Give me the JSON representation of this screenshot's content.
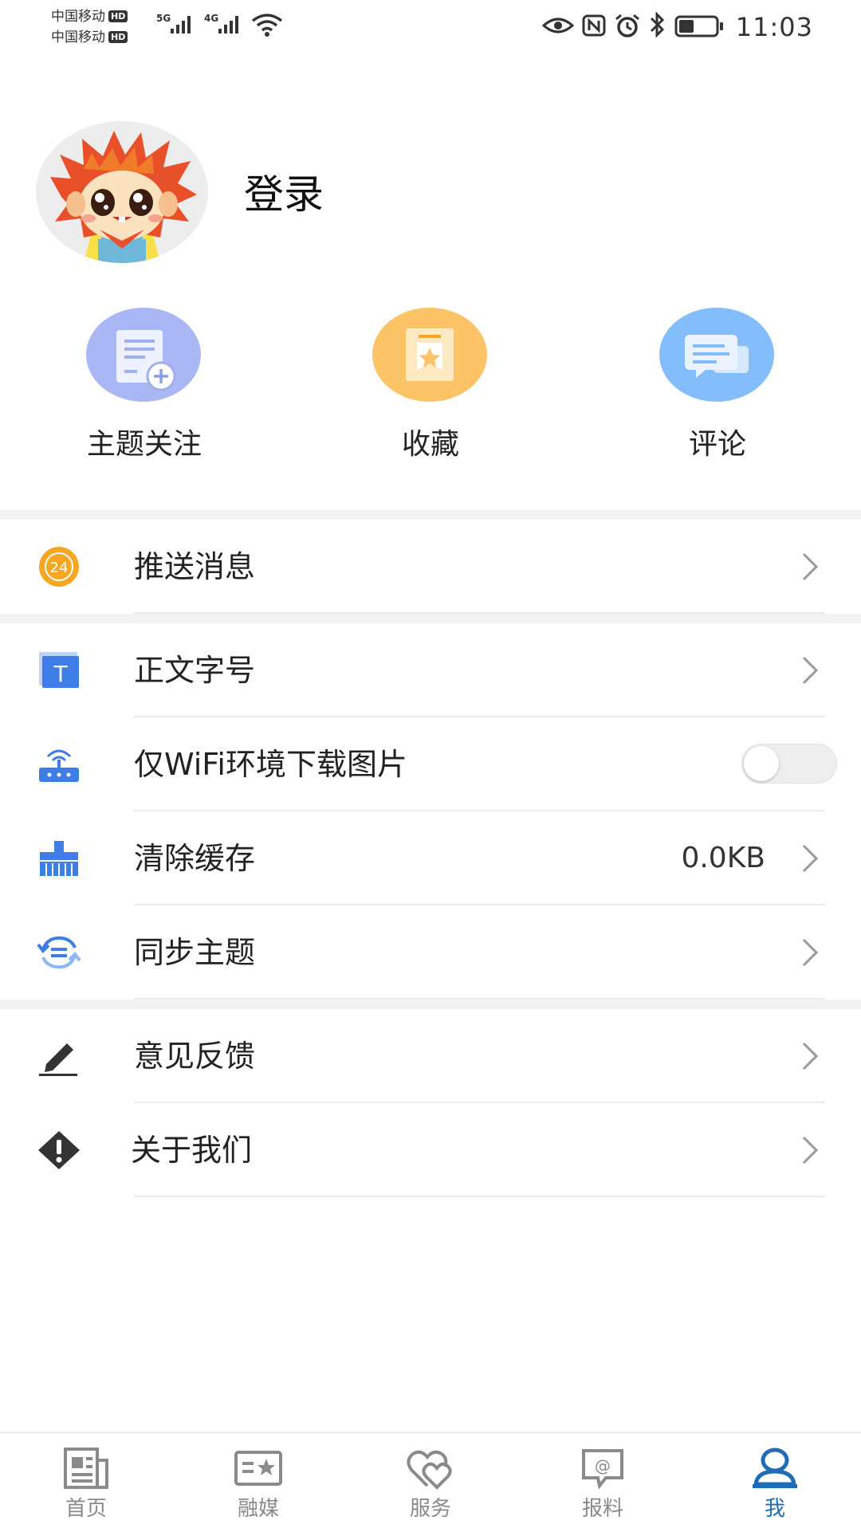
{
  "status_bar": {
    "carrier1": "中国移动",
    "carrier2": "中国移动",
    "hd_badge": "HD",
    "network1": "5G",
    "network2": "4G",
    "time": "11:03",
    "icons": [
      "eye-icon",
      "nfc-icon",
      "alarm-icon",
      "bluetooth-icon",
      "battery-icon",
      "wifi-icon",
      "signal-icon"
    ]
  },
  "profile": {
    "login_label": "登录",
    "avatar_icon": "cartoon-lion-avatar"
  },
  "quick_actions": [
    {
      "label": "主题关注",
      "icon": "topic-follow-icon",
      "color": "#a9b8f5"
    },
    {
      "label": "收藏",
      "icon": "favorite-bookmark-icon",
      "color": "#fcc367"
    },
    {
      "label": "评论",
      "icon": "comment-bubbles-icon",
      "color": "#84bdfb"
    }
  ],
  "settings": {
    "push": {
      "label": "推送消息",
      "icon": "24h-clock-icon",
      "badge": "24"
    },
    "font_size": {
      "label": "正文字号",
      "icon": "text-size-icon",
      "glyph": "T"
    },
    "wifi_only": {
      "label": "仅WiFi环境下载图片",
      "icon": "router-icon",
      "enabled": false
    },
    "clear_cache": {
      "label": "清除缓存",
      "icon": "broom-icon",
      "value": "0.0KB"
    },
    "sync_topics": {
      "label": "同步主题",
      "icon": "sync-icon"
    },
    "feedback": {
      "label": "意见反馈",
      "icon": "pencil-icon"
    },
    "about": {
      "label": "关于我们",
      "icon": "warning-diamond-icon"
    }
  },
  "bottom_nav": [
    {
      "label": "首页",
      "icon": "newspaper-icon",
      "active": false
    },
    {
      "label": "融媒",
      "icon": "media-card-icon",
      "active": false
    },
    {
      "label": "服务",
      "icon": "heart-service-icon",
      "active": false
    },
    {
      "label": "报料",
      "icon": "at-chat-icon",
      "active": false
    },
    {
      "label": "我",
      "icon": "user-profile-icon",
      "active": true
    }
  ],
  "colors": {
    "accent": "#1f6db8",
    "icon_blue": "#3f7de6",
    "badge_orange": "#f5a623",
    "section_gap": "#f3f3f3"
  }
}
